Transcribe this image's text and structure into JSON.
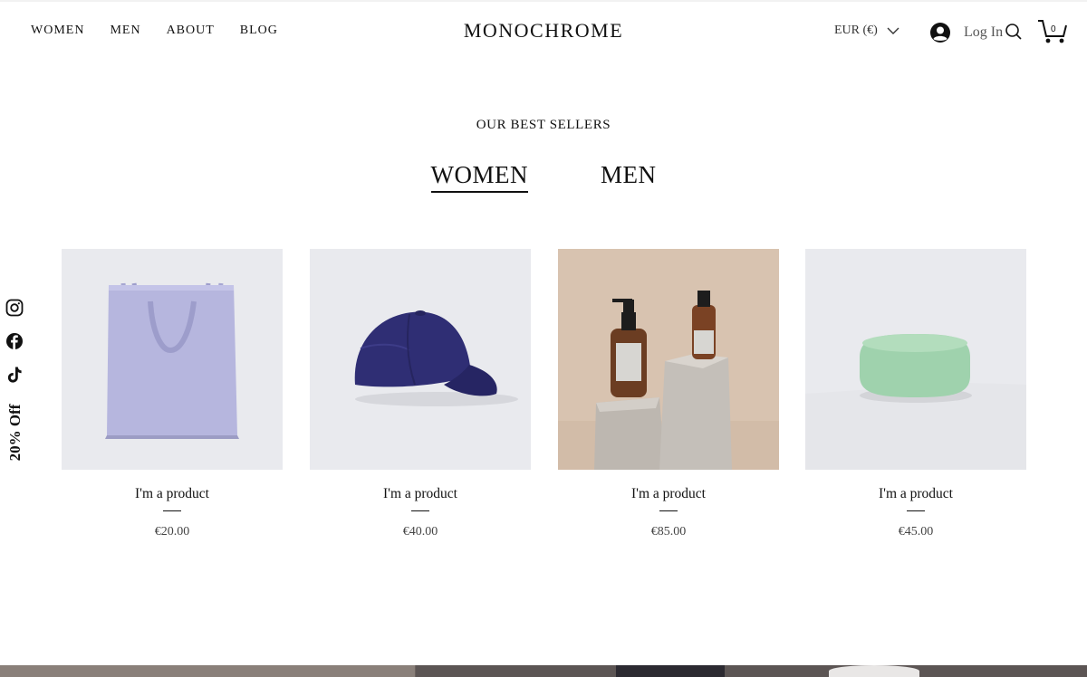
{
  "header": {
    "nav": [
      {
        "label": "WOMEN"
      },
      {
        "label": "MEN"
      },
      {
        "label": "ABOUT"
      },
      {
        "label": "BLOG"
      }
    ],
    "brand": "MONOCHROME",
    "currency": "EUR (€)",
    "login_label": "Log In",
    "cart_count": "0"
  },
  "section": {
    "title": "OUR BEST SELLERS",
    "tabs": [
      {
        "label": "WOMEN",
        "active": true
      },
      {
        "label": "MEN",
        "active": false
      }
    ]
  },
  "social": {
    "icons": [
      "instagram-icon",
      "facebook-icon",
      "tiktok-icon"
    ],
    "promo": "20% Off"
  },
  "products": [
    {
      "name": "I'm a product",
      "price": "€20.00",
      "image": "tote-bag"
    },
    {
      "name": "I'm a product",
      "price": "€40.00",
      "image": "baseball-cap"
    },
    {
      "name": "I'm a product",
      "price": "€85.00",
      "image": "amber-bottles"
    },
    {
      "name": "I'm a product",
      "price": "€45.00",
      "image": "green-soap"
    }
  ],
  "colors": {
    "text": "#111111",
    "card_bg": "#e9eaee",
    "tote": "#b6b6de",
    "cap": "#2f2e74",
    "bottles_bg": "#d8c3b0",
    "soap": "#9fd2ad"
  }
}
